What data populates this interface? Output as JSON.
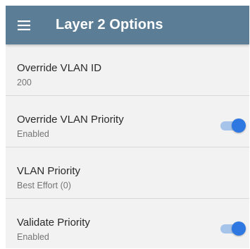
{
  "appbar": {
    "title": "Layer 2 Options",
    "menu_icon": "hamburger-menu-icon"
  },
  "settings": [
    {
      "title": "Override VLAN ID",
      "value": "200",
      "toggle": false
    },
    {
      "title": "Override VLAN Priority",
      "value": "Enabled",
      "toggle": true,
      "toggle_on": true
    },
    {
      "title": "VLAN Priority",
      "value": "Best Effort (0)",
      "toggle": false
    },
    {
      "title": "Validate Priority",
      "value": "Enabled",
      "toggle": true,
      "toggle_on": true
    }
  ],
  "colors": {
    "appbar": "#5c7d96",
    "background": "#f2f2f2",
    "toggle_thumb": "#2f77e1",
    "toggle_track": "#a6c4ea"
  }
}
